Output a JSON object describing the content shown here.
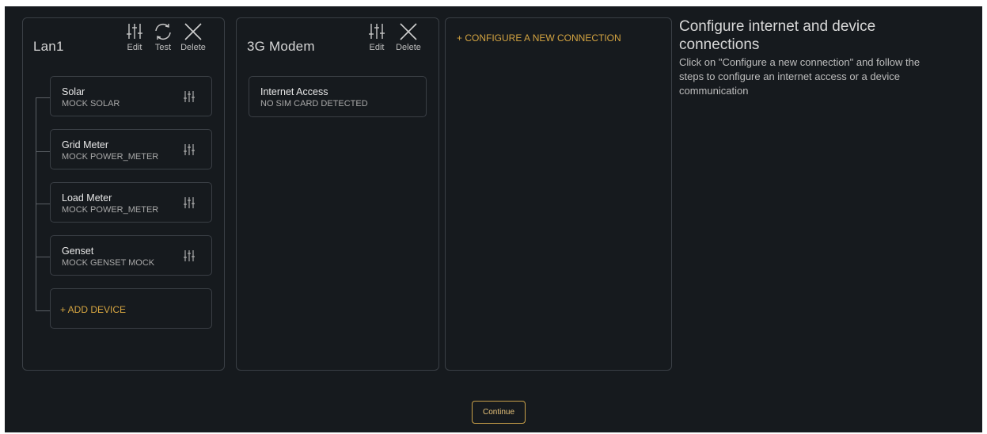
{
  "lan_panel": {
    "title": "Lan1",
    "actions": {
      "edit": "Edit",
      "test": "Test",
      "delete": "Delete"
    },
    "devices": [
      {
        "name": "Solar",
        "type": "MOCK SOLAR"
      },
      {
        "name": "Grid Meter",
        "type": "MOCK POWER_METER"
      },
      {
        "name": "Load Meter",
        "type": "MOCK POWER_METER"
      },
      {
        "name": "Genset",
        "type": "MOCK GENSET MOCK"
      }
    ],
    "add_device": "+ ADD DEVICE"
  },
  "modem_panel": {
    "title": "3G Modem",
    "actions": {
      "edit": "Edit",
      "delete": "Delete"
    },
    "card": {
      "name": "Internet Access",
      "status": "NO SIM CARD DETECTED"
    }
  },
  "new_panel": {
    "link": "+ CONFIGURE A NEW CONNECTION"
  },
  "info": {
    "title": "Configure internet and device connections",
    "text": "Click on \"Configure a new connection\" and follow the steps to configure an internet access or a device communication"
  },
  "continue_label": "Continue",
  "icons": {
    "settings": "sliders-icon",
    "test": "refresh-icon",
    "delete": "close-icon"
  },
  "colors": {
    "background": "#161a1e",
    "accent": "#d4a441",
    "border": "#3a3f45"
  }
}
